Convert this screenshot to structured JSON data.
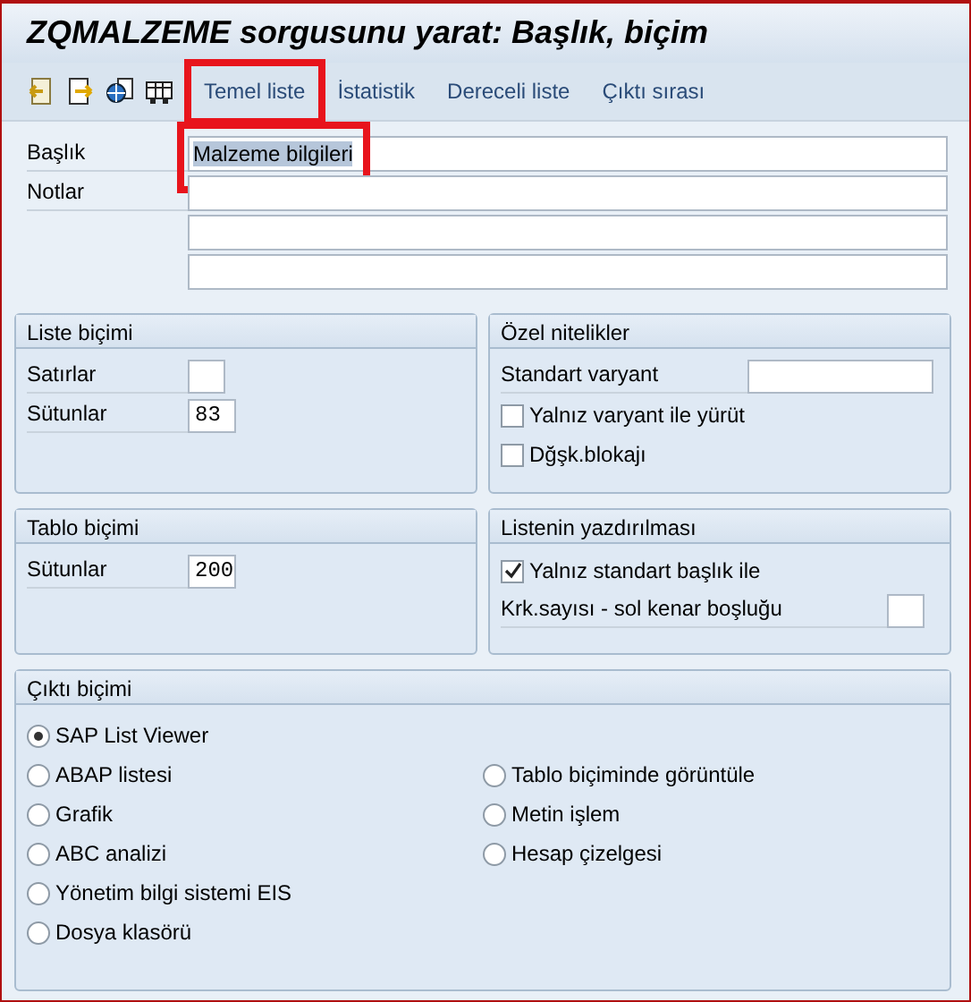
{
  "window": {
    "title": "ZQMALZEME sorgusunu yarat: Başlık, biçim"
  },
  "toolbar": {
    "icons": [
      {
        "kind": "back-doc"
      },
      {
        "kind": "forward-doc"
      },
      {
        "kind": "globe-doc"
      },
      {
        "kind": "table"
      }
    ],
    "tabs": [
      {
        "label": "Temel liste",
        "highlighted": true
      },
      {
        "label": "İstatistik",
        "highlighted": false
      },
      {
        "label": "Dereceli liste",
        "highlighted": false
      },
      {
        "label": "Çıktı sırası",
        "highlighted": false
      }
    ]
  },
  "header": {
    "fields": [
      {
        "label": "Başlık",
        "value": "Malzeme bilgileri",
        "selected_text": true,
        "highlighted": true
      },
      {
        "label": "Notlar",
        "highlighted": false
      },
      {
        "highlighted": false
      },
      {
        "highlighted": false
      }
    ]
  },
  "groups": [
    {
      "title": "Liste biçimi",
      "rows": [
        {
          "kind": "field",
          "label": "Satırlar"
        },
        {
          "kind": "field",
          "label": "Sütunlar",
          "value": "83"
        }
      ]
    },
    {
      "title": "Özel nitelikler",
      "rows": [
        {
          "kind": "wide-field",
          "label": "Standart varyant"
        },
        {
          "kind": "checkbox",
          "label": "Yalnız varyant ile yürüt",
          "checked": false
        },
        {
          "kind": "checkbox",
          "label": "Dğşk.blokajı",
          "checked": false
        }
      ]
    },
    {
      "title": "Tablo biçimi",
      "rows": [
        {
          "kind": "field",
          "label": "Sütunlar",
          "value": "200"
        }
      ]
    },
    {
      "title": "Listenin yazdırılması",
      "rows": [
        {
          "kind": "checkbox",
          "label": "Yalnız standart başlık ile",
          "checked": true
        },
        {
          "kind": "field",
          "label": "Krk.sayısı - sol kenar boşluğu"
        }
      ]
    }
  ],
  "output_format": {
    "title": "Çıktı biçimi",
    "columns": [
      [
        {
          "label": "SAP List Viewer",
          "selected": true
        },
        {
          "label": "ABAP listesi",
          "selected": false
        },
        {
          "label": "Grafik",
          "selected": false
        },
        {
          "label": "ABC analizi",
          "selected": false
        },
        {
          "label": "Yönetim bilgi sistemi EIS",
          "selected": false
        },
        {
          "label": "Dosya klasörü",
          "selected": false
        }
      ],
      [
        {
          "label": "Tablo biçiminde görüntüle",
          "selected": false
        },
        {
          "label": "Metin işlem",
          "selected": false
        },
        {
          "label": "Hesap çizelgesi",
          "selected": false
        }
      ]
    ]
  }
}
